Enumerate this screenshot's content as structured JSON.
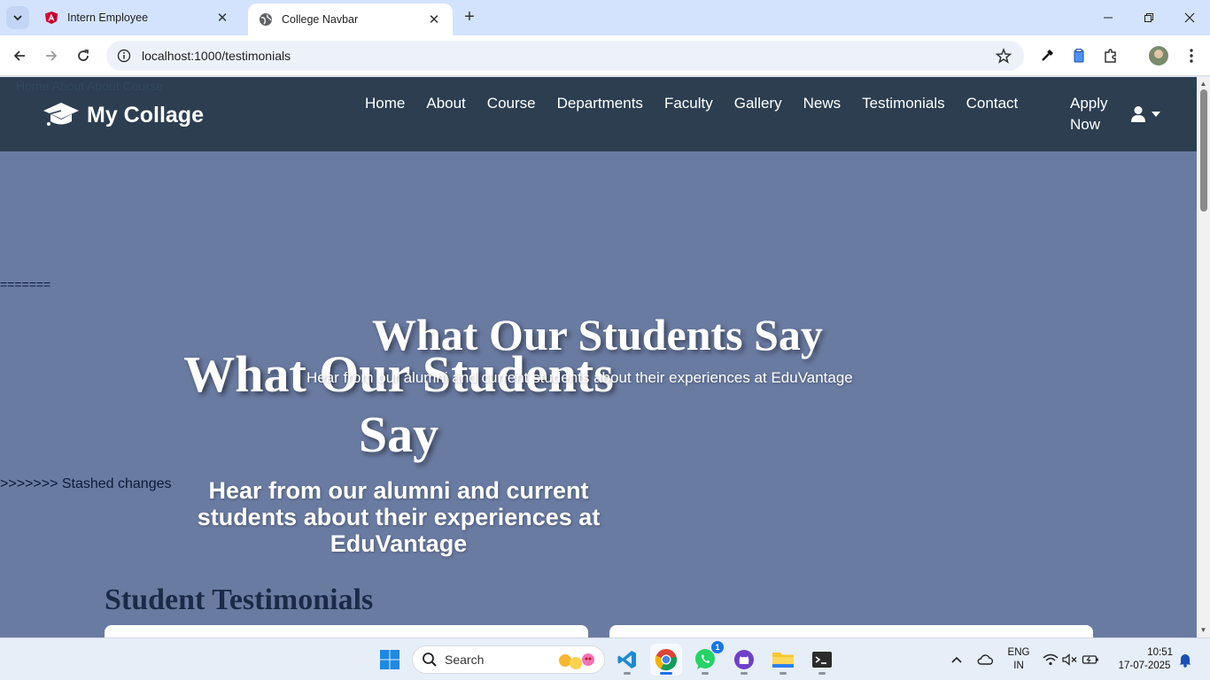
{
  "browser": {
    "tabs": [
      {
        "title": "Intern Employee",
        "favicon": "angular-icon",
        "active": false
      },
      {
        "title": "College Navbar",
        "favicon": "globe-icon",
        "active": true
      }
    ],
    "url": "localhost:1000/testimonials"
  },
  "page": {
    "ghost_text": "Home About About Course",
    "brand": "My Collage",
    "nav_links": [
      "Home",
      "About",
      "Course",
      "Departments",
      "Faculty",
      "Gallery",
      "News",
      "Testimonials",
      "Contact"
    ],
    "apply_now": "Apply Now",
    "merge_marker": "=======",
    "stash_marker": ">>>>>>> Stashed changes",
    "hero_a": {
      "title": "What Our Students Say",
      "subtitle": "Hear from our alumni and current students about their experiences at EduVantage"
    },
    "hero_b": {
      "title": "What Our Students Say",
      "subtitle": "Hear from our alumni and current students about their experiences at EduVantage"
    },
    "section_title": "Student Testimonials",
    "colors": {
      "nav_bg": "#2c3e50",
      "hero_bg": "#6a7ba2",
      "heading_dark": "#1a2a47"
    }
  },
  "taskbar": {
    "search_placeholder": "Search",
    "apps": [
      "windows-start-icon",
      "vscode-icon",
      "chrome-icon",
      "whatsapp-icon",
      "github-desktop-icon",
      "file-explorer-icon",
      "terminal-icon"
    ],
    "whatsapp_badge": "1",
    "lang_line1": "ENG",
    "lang_line2": "IN",
    "time": "10:51",
    "date": "17-07-2025"
  }
}
